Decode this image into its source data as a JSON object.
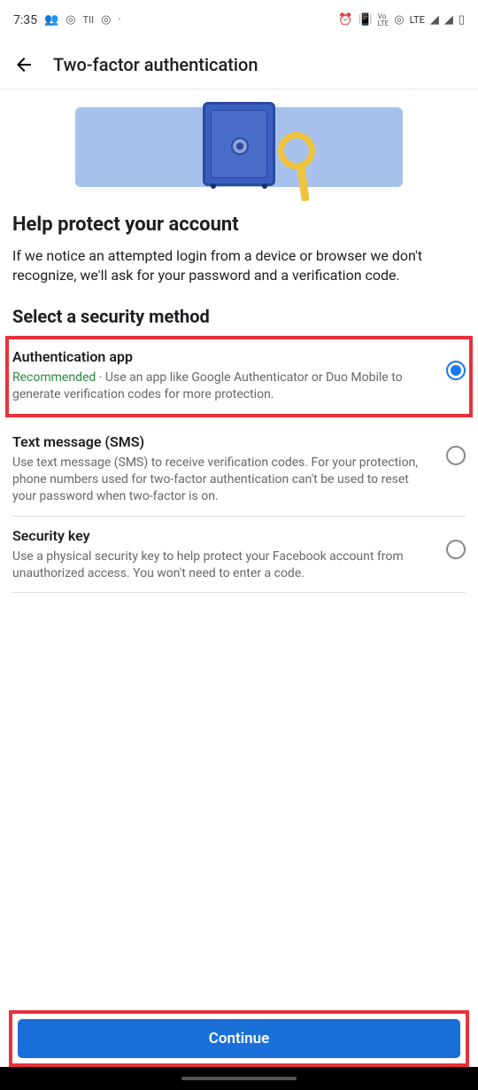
{
  "status_bar": {
    "time": "7:35",
    "network_label": "LTE"
  },
  "app_bar": {
    "title": "Two-factor authentication"
  },
  "hero": {
    "alt": "Safe with magnifying glass illustration"
  },
  "intro": {
    "heading": "Help protect your account",
    "text": "If we notice an attempted login from a device or browser we don't recognize, we'll ask for your password and a verification code."
  },
  "method_section": {
    "heading": "Select a security method"
  },
  "options": [
    {
      "title": "Authentication app",
      "recommended": "Recommended",
      "desc": " · Use an app like Google Authenticator or Duo Mobile to generate verification codes for more protection.",
      "selected": true
    },
    {
      "title": "Text message (SMS)",
      "desc": "Use text message (SMS) to receive verification codes. For your protection, phone numbers used for two-factor authentication can't be used to reset your password when two-factor is on.",
      "selected": false
    },
    {
      "title": "Security key",
      "desc": "Use a physical security key to help protect your Facebook account from unauthorized access. You won't need to enter a code.",
      "selected": false
    }
  ],
  "footer": {
    "continue": "Continue"
  }
}
